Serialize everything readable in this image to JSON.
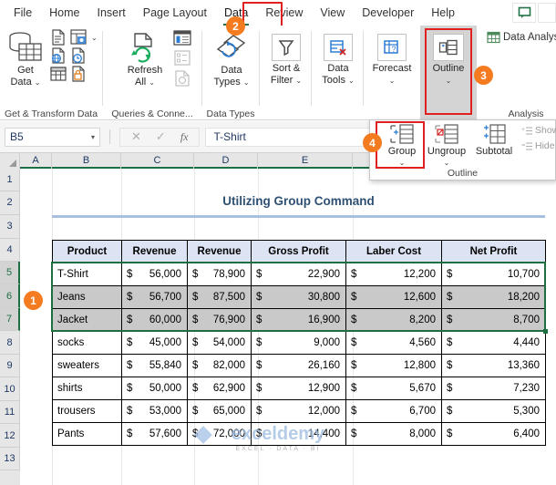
{
  "tabs": [
    {
      "label": "File",
      "active": false
    },
    {
      "label": "Home",
      "active": false
    },
    {
      "label": "Insert",
      "active": false
    },
    {
      "label": "Page Layout",
      "active": false
    },
    {
      "label": "Data",
      "active": true
    },
    {
      "label": "Review",
      "active": false
    },
    {
      "label": "View",
      "active": false
    },
    {
      "label": "Developer",
      "active": false
    },
    {
      "label": "Help",
      "active": false
    }
  ],
  "ribbon": {
    "groups": [
      {
        "name": "Get & Transform Data",
        "label": "Get & Transform Data"
      },
      {
        "name": "Queries & Connections",
        "label": "Queries & Conne..."
      },
      {
        "name": "Data Types",
        "label": "Data Types"
      },
      {
        "name": "Sort & Filter",
        "label": ""
      },
      {
        "name": "Analysis",
        "label": "Analysis"
      }
    ],
    "get_data": "Get\nData",
    "get_data_l1": "Get",
    "get_data_l2": "Data",
    "refresh_l1": "Refresh",
    "refresh_l2": "All",
    "datatypes_l1": "Data",
    "datatypes_l2": "Types",
    "sortfilter_l1": "Sort &",
    "sortfilter_l2": "Filter",
    "datatools_l1": "Data",
    "datatools_l2": "Tools",
    "forecast_l1": "Forecast",
    "outline_l1": "Outline",
    "data_analysis": "Data Analysi",
    "analysis_group": "Analysis",
    "get_transform_group": "Get & Transform Data",
    "queries_group": "Queries & Conne...",
    "datatypes_group": "Data Types"
  },
  "outline_dropdown": {
    "group": "Group",
    "ungroup": "Ungroup",
    "subtotal": "Subtotal",
    "show_detail": "Show",
    "hide_detail": "Hide D",
    "group_label": "Outline"
  },
  "formula_bar": {
    "name_box": "B5",
    "cancel_icon": "✕",
    "confirm_icon": "✓",
    "function_icon": "fx",
    "value": "T-Shirt"
  },
  "grid": {
    "columns": [
      "A",
      "B",
      "C",
      "D",
      "E"
    ],
    "rows": [
      "1",
      "2",
      "3",
      "4",
      "5",
      "6",
      "7",
      "8",
      "9",
      "10",
      "11",
      "12",
      "13"
    ],
    "selected_rows": [
      "5",
      "6",
      "7"
    ]
  },
  "sheet": {
    "title": "Utilizing Group Command",
    "table": {
      "headers": [
        "Product",
        "Revenue",
        "Revenue",
        "Gross Profit",
        "Laber Cost",
        "Net Profit"
      ],
      "rows": [
        {
          "product": "T-Shirt",
          "revenue1": "56,000",
          "revenue2": "78,900",
          "gross_profit": "22,900",
          "labor_cost": "12,200",
          "net_profit": "10,700",
          "state": "active"
        },
        {
          "product": "Jeans",
          "revenue1": "56,700",
          "revenue2": "87,500",
          "gross_profit": "30,800",
          "labor_cost": "12,600",
          "net_profit": "18,200",
          "state": "selected"
        },
        {
          "product": "Jacket",
          "revenue1": "60,000",
          "revenue2": "76,900",
          "gross_profit": "16,900",
          "labor_cost": "8,200",
          "net_profit": "8,700",
          "state": "selected"
        },
        {
          "product": "socks",
          "revenue1": "45,000",
          "revenue2": "54,000",
          "gross_profit": "9,000",
          "labor_cost": "4,560",
          "net_profit": "4,440",
          "state": "normal"
        },
        {
          "product": "sweaters",
          "revenue1": "55,840",
          "revenue2": "82,000",
          "gross_profit": "26,160",
          "labor_cost": "12,800",
          "net_profit": "13,360",
          "state": "normal"
        },
        {
          "product": "shirts",
          "revenue1": "50,000",
          "revenue2": "62,900",
          "gross_profit": "12,900",
          "labor_cost": "5,670",
          "net_profit": "7,230",
          "state": "normal"
        },
        {
          "product": "trousers",
          "revenue1": "53,000",
          "revenue2": "65,000",
          "gross_profit": "12,000",
          "labor_cost": "6,700",
          "net_profit": "5,300",
          "state": "normal"
        },
        {
          "product": "Pants",
          "revenue1": "57,600",
          "revenue2": "72,000",
          "gross_profit": "14,400",
          "labor_cost": "8,000",
          "net_profit": "6,400",
          "state": "normal"
        }
      ],
      "currency_symbol": "$"
    }
  },
  "callouts": [
    {
      "number": "1",
      "target": "selected-rows"
    },
    {
      "number": "2",
      "target": "data-tab"
    },
    {
      "number": "3",
      "target": "outline-button"
    },
    {
      "number": "4",
      "target": "group-button"
    }
  ],
  "watermark": {
    "line1": "exceldemy",
    "line2": "EXCEL · DATA · BI"
  },
  "colors": {
    "accent_green": "#217346",
    "callout_orange": "#f47b20",
    "highlight_red": "#e02020",
    "header_fill": "#dce3f2",
    "selection_gray": "#c9c9c9",
    "title_blue": "#2e5073"
  }
}
